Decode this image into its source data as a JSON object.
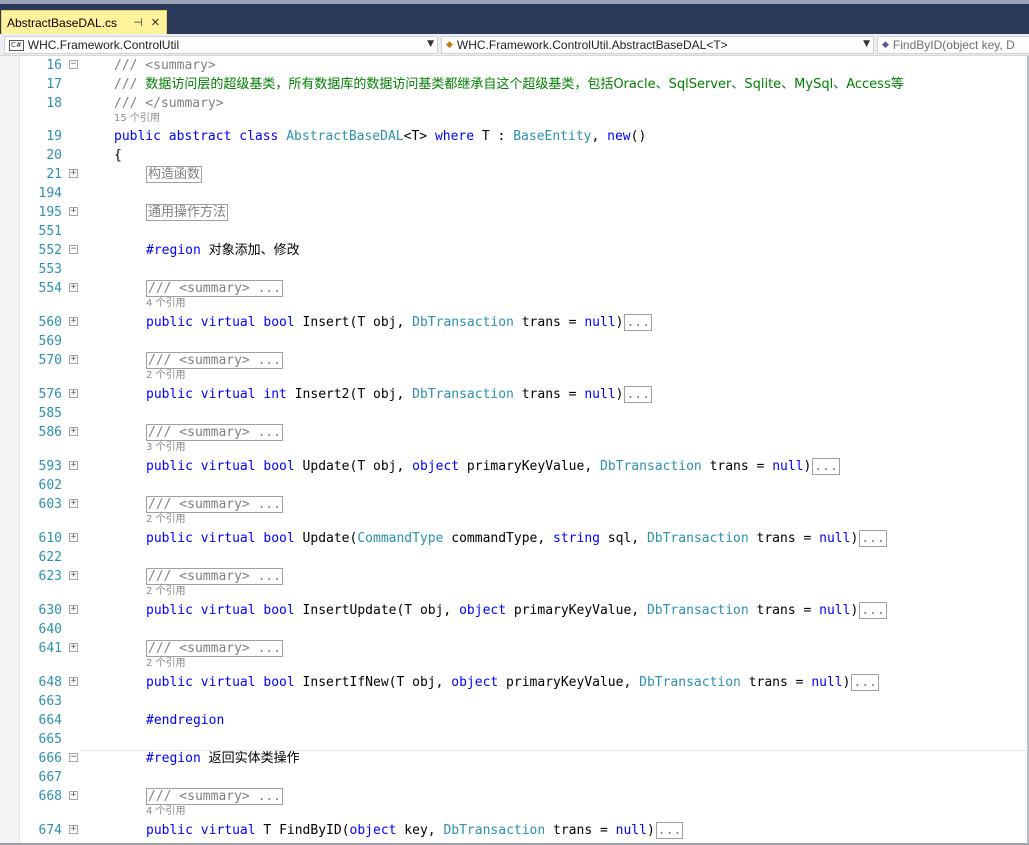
{
  "tab": {
    "title": "AbstractBaseDAL.cs",
    "pin_icon": "pin-icon",
    "close_icon": "close-icon"
  },
  "navbar": {
    "project": "WHC.Framework.ControlUtil",
    "class": "WHC.Framework.ControlUtil.AbstractBaseDAL<T>",
    "member": "FindByID(object key, D"
  },
  "editor": {
    "line_numbers": [
      "16",
      "17",
      "18",
      "19",
      "20",
      "21",
      "194",
      "195",
      "551",
      "552",
      "553",
      "554",
      "560",
      "569",
      "570",
      "576",
      "585",
      "586",
      "593",
      "602",
      "603",
      "610",
      "622",
      "623",
      "630",
      "640",
      "641",
      "648",
      "663",
      "664",
      "665",
      "666",
      "667",
      "668",
      "674"
    ],
    "summary_open": "/// <summary>",
    "summary_desc_prefix": "/// ",
    "summary_desc": "数据访问层的超级基类，所有数据库的数据访问基类都继承自这个超级基类，包括Oracle、SqlServer、Sqlite、MySql、Access等",
    "summary_close": "/// </summary>",
    "refs": {
      "class": "15 个引用",
      "insert": "4 个引用",
      "insert2": "2 个引用",
      "update1": "3 个引用",
      "update2": "2 个引用",
      "insertupdate": "2 个引用",
      "insertifnew": "2 个引用",
      "findbyid": "4 个引用"
    },
    "collapsed_summary": "/// <summary> ...",
    "collapsed_dots": "...",
    "class_decl": {
      "public": "public",
      "abstract": "abstract",
      "class_kw": "class",
      "name": "AbstractBaseDAL",
      "generic": "<T>",
      "where": "where",
      "t_colon": " T : ",
      "base": "BaseEntity",
      "new_kw": "new",
      "paren": "()"
    },
    "open_brace": "{",
    "region_ctor": "构造函数",
    "region_common": "通用操作方法",
    "region_kw": "#region",
    "region_add_modify": "对象添加、修改",
    "endregion": "#endregion",
    "region_return": "返回实体类操作",
    "methods": {
      "insert": {
        "mods": "public virtual",
        "ret": "bool",
        "name": "Insert",
        "p1": "(T obj, ",
        "t1": "DbTransaction",
        "p2": " trans = ",
        "null": "null",
        "close": ")"
      },
      "insert2": {
        "mods": "public virtual",
        "ret": "int",
        "name": "Insert2",
        "p1": "(T obj, ",
        "t1": "DbTransaction",
        "p2": " trans = ",
        "null": "null",
        "close": ")"
      },
      "update1": {
        "mods": "public virtual",
        "ret": "bool",
        "name": "Update",
        "p1": "(T obj, ",
        "k1": "object",
        "p2": " primaryKeyValue, ",
        "t1": "DbTransaction",
        "p3": " trans = ",
        "null": "null",
        "close": ")"
      },
      "update2": {
        "mods": "public virtual",
        "ret": "bool",
        "name": "Update",
        "open": "(",
        "t0": "CommandType",
        "p1": " commandType, ",
        "k1": "string",
        "p2": " sql, ",
        "t1": "DbTransaction",
        "p3": " trans = ",
        "null": "null",
        "close": ")"
      },
      "insertupdate": {
        "mods": "public virtual",
        "ret": "bool",
        "name": "InsertUpdate",
        "p1": "(T obj, ",
        "k1": "object",
        "p2": " primaryKeyValue, ",
        "t1": "DbTransaction",
        "p3": " trans = ",
        "null": "null",
        "close": ")"
      },
      "insertifnew": {
        "mods": "public virtual",
        "ret": "bool",
        "name": "InsertIfNew",
        "p1": "(T obj, ",
        "k1": "object",
        "p2": " primaryKeyValue, ",
        "t1": "DbTransaction",
        "p3": " trans = ",
        "null": "null",
        "close": ")"
      },
      "findbyid": {
        "mods": "public virtual",
        "ret": "T",
        "name": "FindByID",
        "open": "(",
        "k1": "object",
        "p1": " key, ",
        "t1": "DbTransaction",
        "p2": " trans = ",
        "null": "null",
        "close": ")"
      }
    }
  },
  "colors": {
    "keyword": "#0000ff",
    "type": "#2b91af",
    "comment": "#008000",
    "line_number": "#2b91af",
    "tab_active": "#fff29d",
    "tab_strip": "#2b3a5b"
  }
}
